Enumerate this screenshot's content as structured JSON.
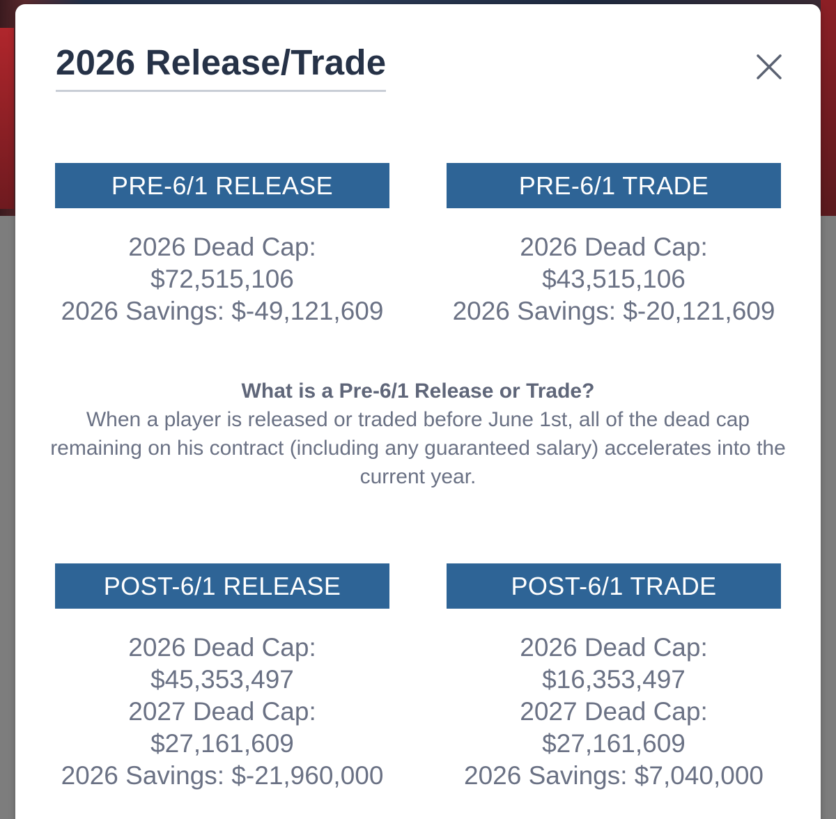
{
  "modal": {
    "title": "2026 Release/Trade"
  },
  "sections": {
    "pre_release": {
      "header": "PRE-6/1 RELEASE",
      "lines": [
        "2026 Dead Cap:",
        "$72,515,106",
        "2026 Savings: $-49,121,609"
      ]
    },
    "pre_trade": {
      "header": "PRE-6/1 TRADE",
      "lines": [
        "2026 Dead Cap:",
        "$43,515,106",
        "2026 Savings: $-20,121,609"
      ]
    },
    "post_release": {
      "header": "POST-6/1 RELEASE",
      "lines": [
        "2026 Dead Cap:",
        "$45,353,497",
        "2027 Dead Cap:",
        "$27,161,609",
        "2026 Savings: $-21,960,000"
      ]
    },
    "post_trade": {
      "header": "POST-6/1 TRADE",
      "lines": [
        "2026 Dead Cap:",
        "$16,353,497",
        "2027 Dead Cap:",
        "$27,161,609",
        "2026 Savings: $7,040,000"
      ]
    }
  },
  "info": {
    "title": "What is a Pre-6/1 Release or Trade?",
    "body": "When a player is released or traded before June 1st, all of the dead cap remaining on his contract (including any guaranteed salary) accelerates into the current year."
  },
  "icons": {
    "close": "close-icon"
  },
  "colors": {
    "header_bg": "#2e6496",
    "title_text": "#263247",
    "body_text": "#6a7184"
  }
}
